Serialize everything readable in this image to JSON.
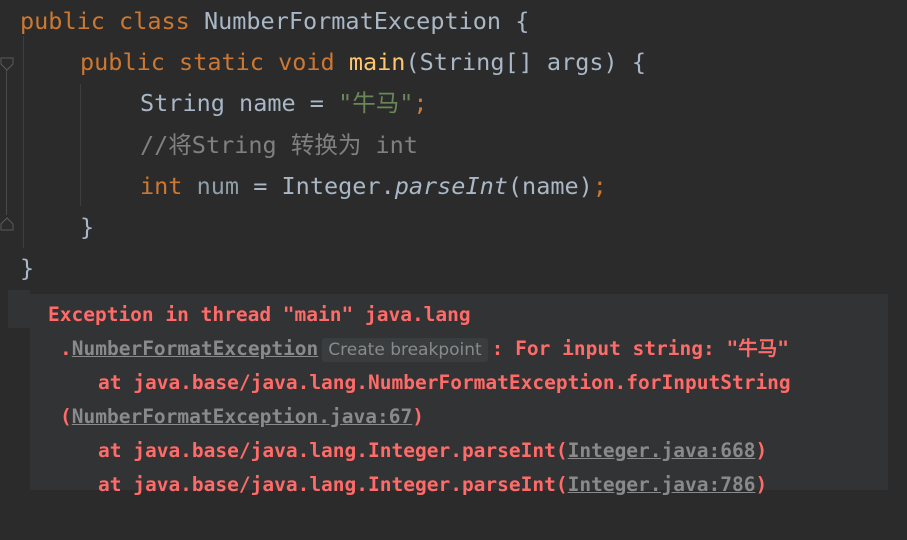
{
  "code": {
    "line1": {
      "kw1": "public",
      "kw2": "class",
      "name": "NumberFormatException",
      "brace": "{"
    },
    "line2": {
      "kw1": "public",
      "kw2": "static",
      "kw3": "void",
      "method": "main",
      "params": "(String[] args)",
      "brace": "{"
    },
    "line3": {
      "type": "String",
      "var": "name",
      "eq": "=",
      "str": "\"牛马\"",
      "semi": ";"
    },
    "line4": {
      "comment": "//将String 转换为 int"
    },
    "line5": {
      "type": "int",
      "var": "num",
      "eq": "=",
      "cls": "Integer.",
      "call": "parseInt",
      "args": "(name)",
      "semi": ";"
    },
    "line6": {
      "brace": "}"
    },
    "line7": {
      "brace": "}"
    }
  },
  "console": {
    "l1": "Exception in thread \"main\" java.lang",
    "l2_pre": ".",
    "l2_link": "NumberFormatException",
    "l2_tip": "Create breakpoint",
    "l2_post": ": For input string: \"牛马\"",
    "l3": "at java.base/java.lang.NumberFormatException.forInputString",
    "l4_pre": "(",
    "l4_link": "NumberFormatException.java:67",
    "l4_post": ")",
    "l5_pre": "at java.base/java.lang.Integer.parseInt(",
    "l5_link": "Integer.java:668",
    "l5_post": ")",
    "l6_pre": "at java.base/java.lang.Integer.parseInt(",
    "l6_link": "Integer.java:786",
    "l6_post": ")"
  },
  "colors": {
    "background": "#2b2b2b",
    "keyword": "#cc7832",
    "method": "#ffc66d",
    "string": "#6a8759",
    "comment": "#808080",
    "error": "#ff6b68"
  }
}
